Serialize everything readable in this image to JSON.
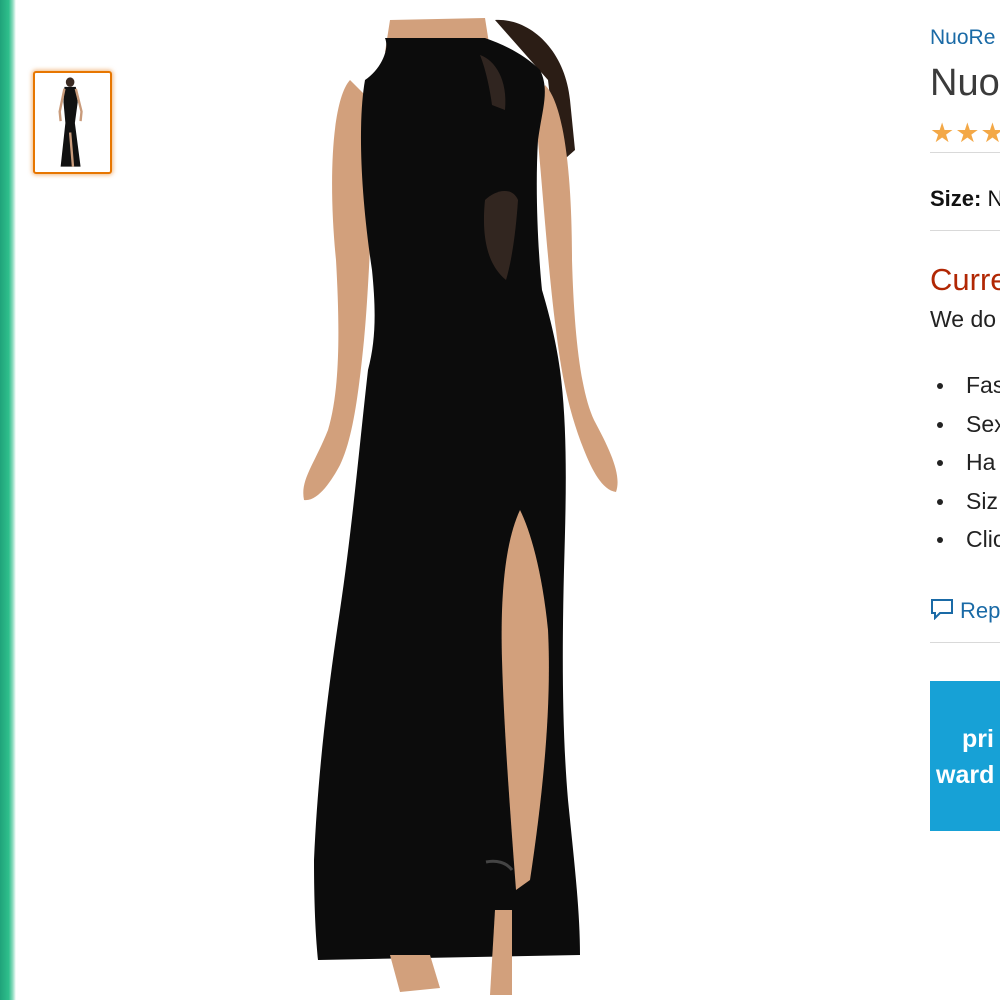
{
  "page": {
    "accent_color": "#e77600",
    "link_color": "#1a6aa6",
    "price_color": "#b12704",
    "promo_color": "#17a1d6"
  },
  "gallery": {
    "thumbnail_icon": "black-maxi-dress-thumbnail",
    "main_image_icon": "black-maxi-dress-photo"
  },
  "product": {
    "brand": "NuoRe",
    "title": "Nuo",
    "stars_text": "★★★",
    "size_label": "Size:",
    "size_value": "N",
    "availability": "Curre",
    "availability_sub": "We do",
    "bullets": [
      "Fas",
      "Sex",
      "Ha",
      "Siz",
      "Clic"
    ],
    "report_icon": "speech-bubble-icon",
    "report_text": "Rep"
  },
  "promo": {
    "line1": "pri",
    "line2": "ward"
  }
}
